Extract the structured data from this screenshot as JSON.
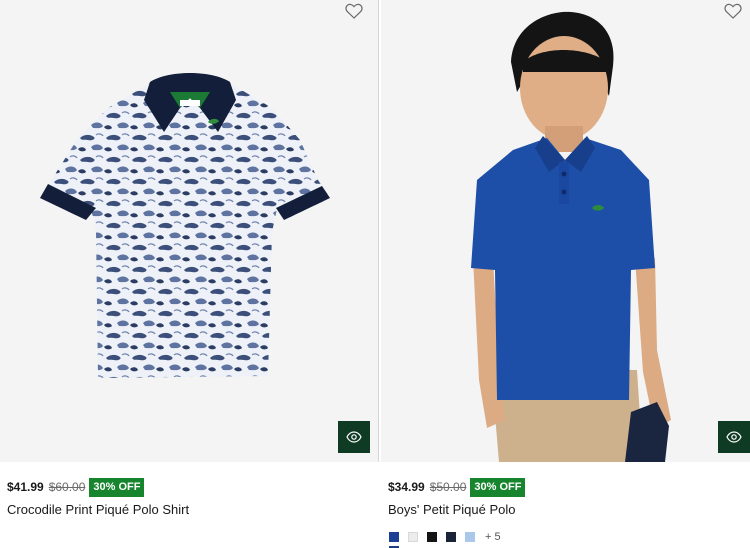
{
  "products": [
    {
      "price": "$41.99",
      "original_price": "$60.00",
      "discount_badge": "30% OFF",
      "name": "Crocodile Print Piqué Polo Shirt",
      "wishlist_icon": "heart-outline-icon",
      "try_on_icon": "eye-icon"
    },
    {
      "price": "$34.99",
      "original_price": "$50.00",
      "discount_badge": "30% OFF",
      "name": "Boys' Petit Piqué Polo",
      "wishlist_icon": "heart-outline-icon",
      "try_on_icon": "eye-icon",
      "swatches": [
        "#1b3f95",
        "#ececec",
        "#141414",
        "#1a2438",
        "#a9c8ea"
      ],
      "more_colors": "+ 5"
    }
  ],
  "colors": {
    "badge_bg": "#17852e",
    "try_on_bg": "#0f3a23",
    "image_bg": "#f4f4f4"
  }
}
